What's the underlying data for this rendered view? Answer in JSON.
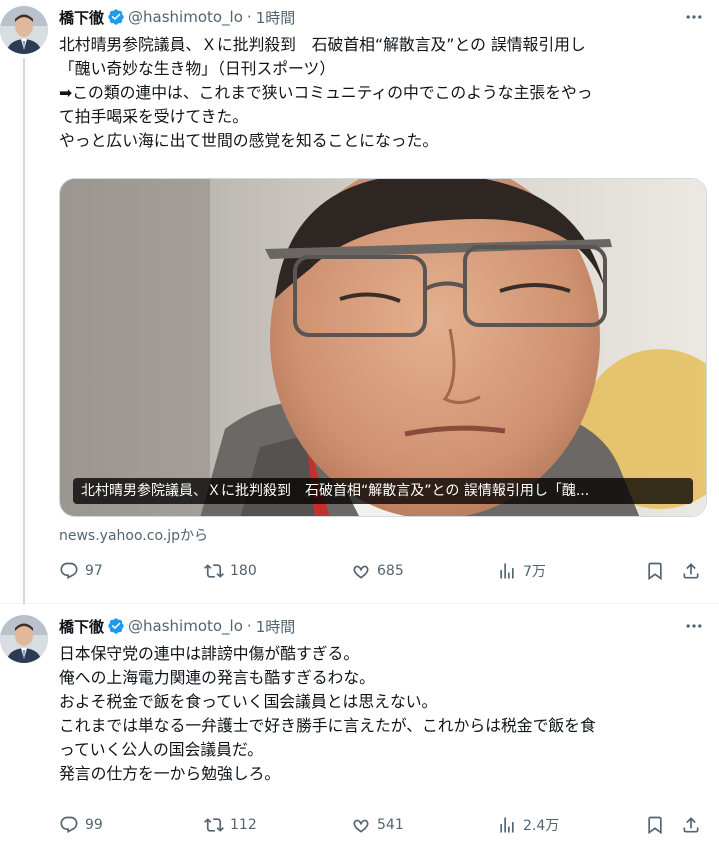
{
  "tweets": [
    {
      "author_name": "橋下徹",
      "handle": "@hashimoto_lo",
      "separator": "·",
      "time": "1時間",
      "text_lines": [
        "北村晴男参院議員、Ｘに批判殺到　石破首相“解散言及”との 誤情報引用し",
        "「醜い奇妙な生き物」（日刊スポーツ）",
        "➡この類の連中は、これまで狭いコミュニティの中でこのような主張をやっ",
        "て拍手喝采を受けてきた。",
        "やっと広い海に出て世間の感覚を知ることになった。"
      ],
      "card": {
        "caption": "北村晴男参院議員、Ｘに批判殺到　石破首相“解散言及”との 誤情報引用し「醜...",
        "source": "news.yahoo.co.jpから"
      },
      "stats": {
        "replies": "97",
        "retweets": "180",
        "likes": "685",
        "views": "7万"
      }
    },
    {
      "author_name": "橋下徹",
      "handle": "@hashimoto_lo",
      "separator": "·",
      "time": "1時間",
      "text_lines": [
        "日本保守党の連中は誹謗中傷が酷すぎる。",
        "俺への上海電力関連の発言も酷すぎるわな。",
        "およそ税金で飯を食っていく国会議員とは思えない。",
        "これまでは単なる一弁護士で好き勝手に言えたが、これからは税金で飯を食",
        "っていく公人の国会議員だ。",
        "発言の仕方を一から勉強しろ。"
      ],
      "stats": {
        "replies": "99",
        "retweets": "112",
        "likes": "541",
        "views": "2.4万"
      }
    }
  ],
  "icons": {
    "verified": "verified-badge-icon",
    "more": "more-options-icon",
    "reply": "reply-icon",
    "retweet": "retweet-icon",
    "like": "heart-icon",
    "views": "views-icon",
    "bookmark": "bookmark-icon",
    "share": "share-icon"
  },
  "colors": {
    "text": "#0f1419",
    "secondary": "#536471",
    "verified": "#1d9bf0",
    "border": "#eff3f4"
  }
}
